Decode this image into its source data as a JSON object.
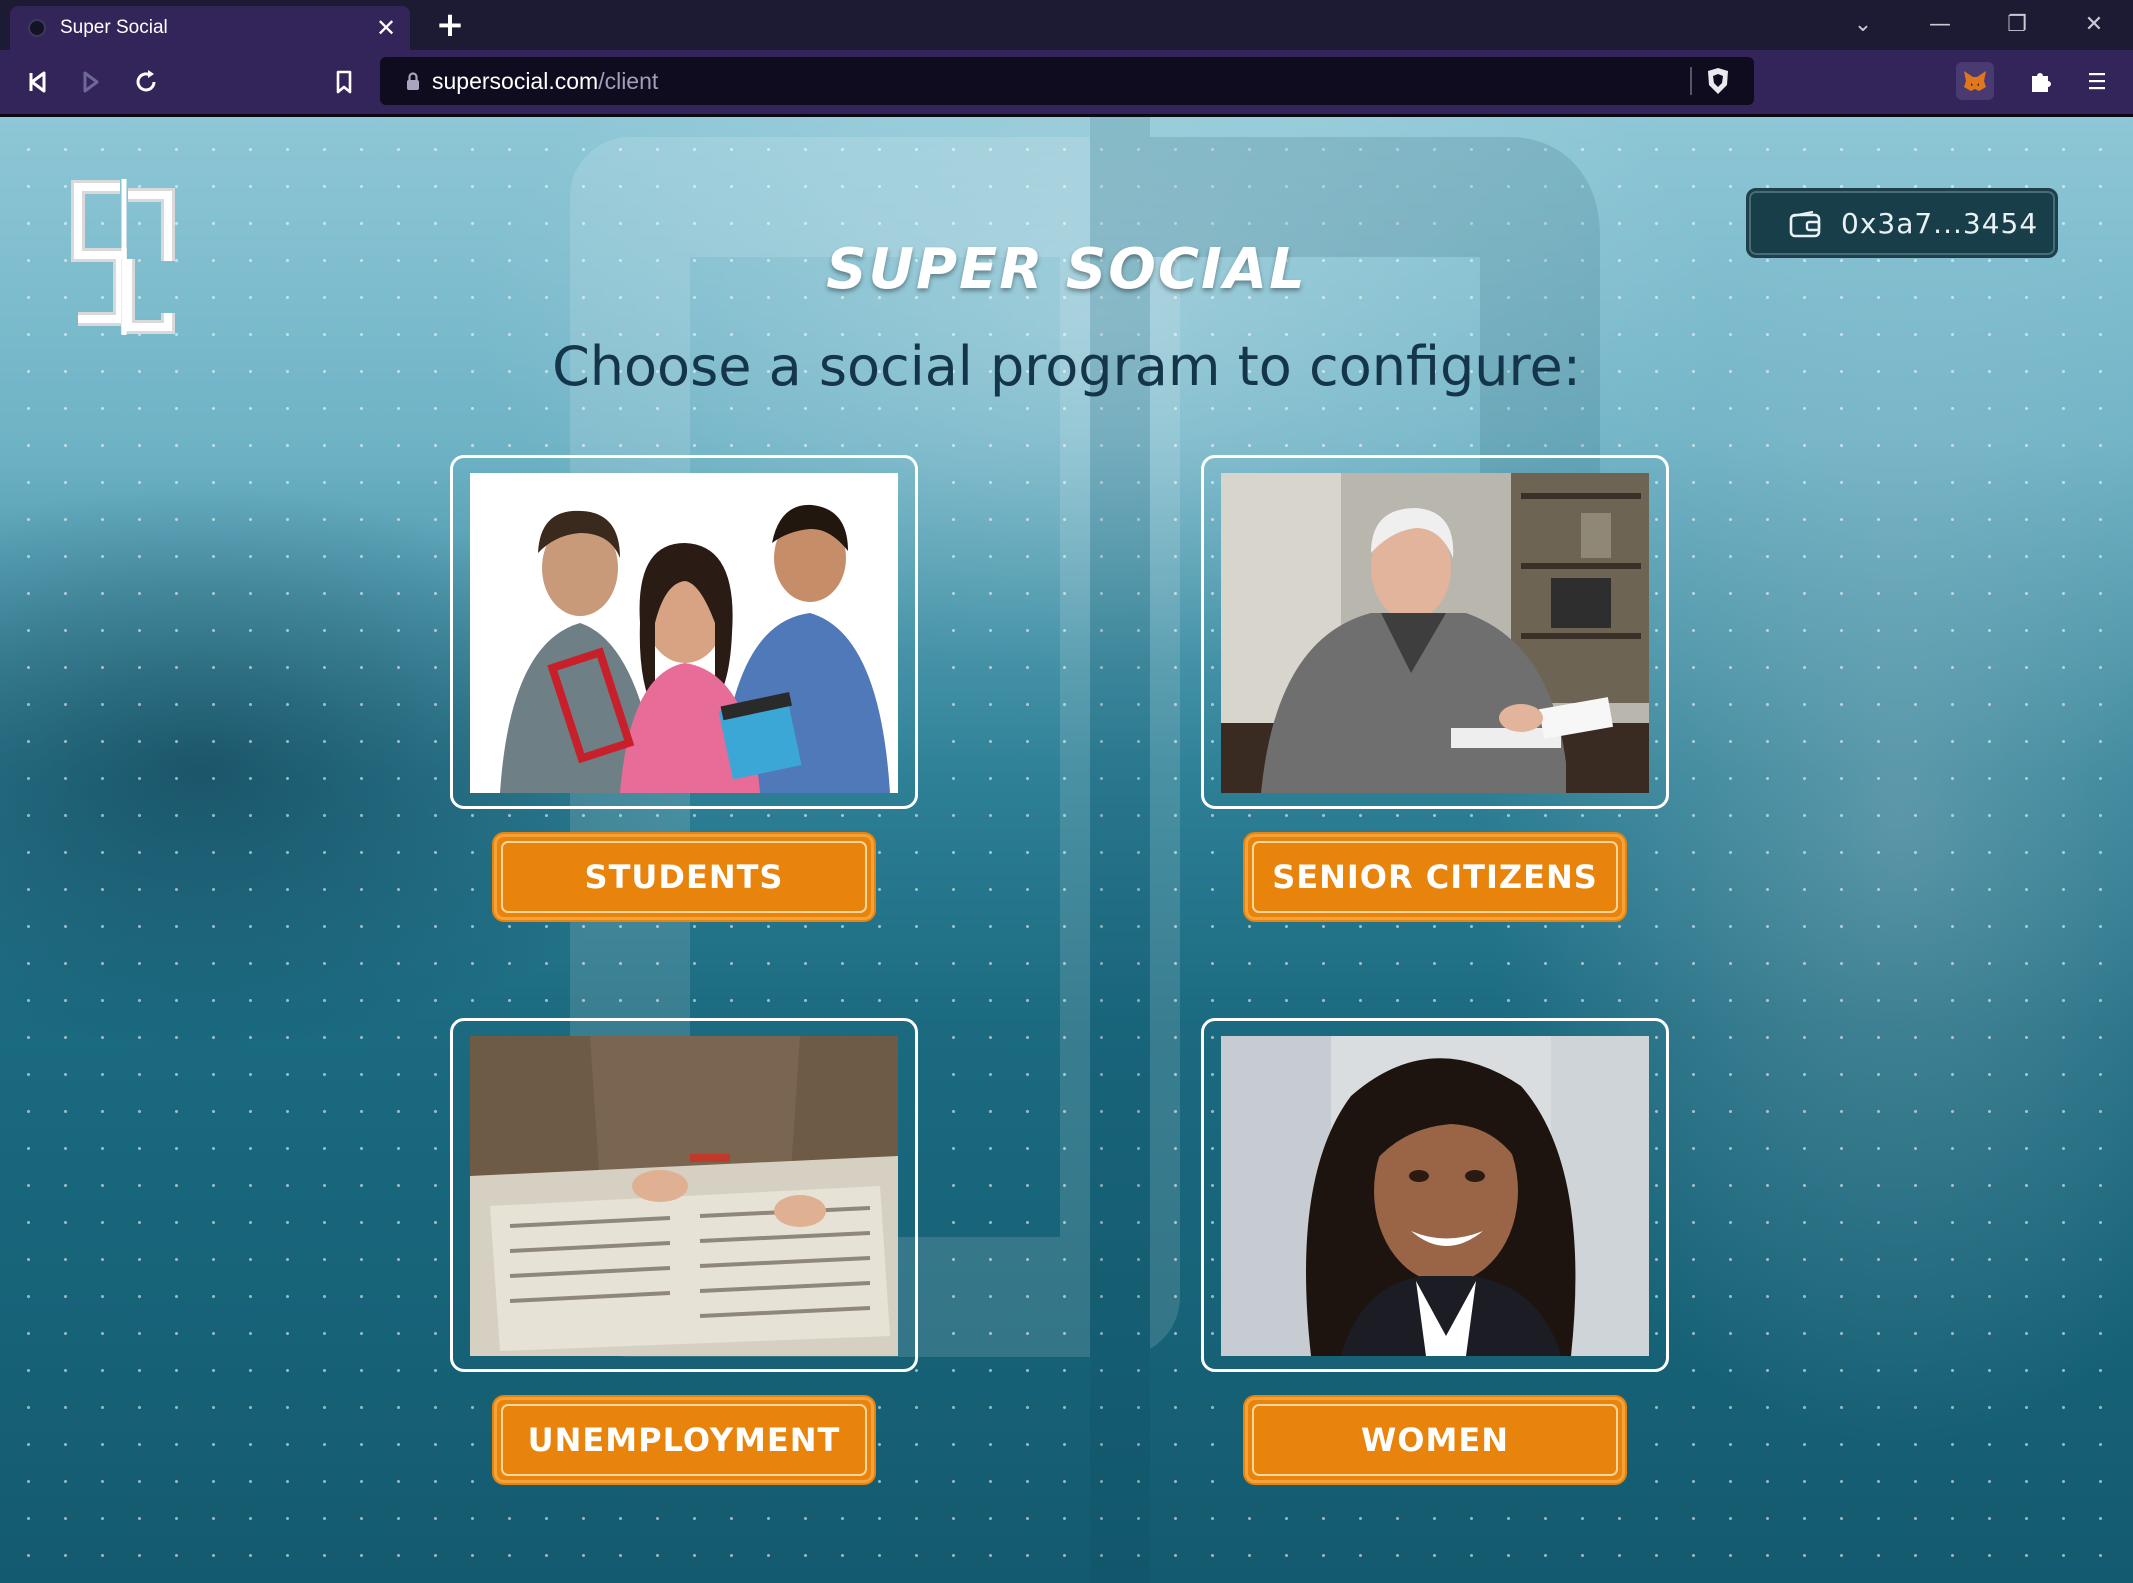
{
  "browser": {
    "tab_title": "Super Social",
    "tab_close": "✕",
    "new_tab": "+",
    "url_host": "supersocial.com",
    "url_path": "/client",
    "window_controls": [
      "⌄",
      "—",
      "❐",
      "✕"
    ]
  },
  "header": {
    "brand": "SUPER SOCIAL",
    "subtitle": "Choose a social program to configure:",
    "wallet_address": "0x3a7...3454"
  },
  "programs": [
    {
      "label": "STUDENTS",
      "image": "students-photo"
    },
    {
      "label": "SENIOR CITIZENS",
      "image": "senior-citizen-photo"
    },
    {
      "label": "UNEMPLOYMENT",
      "image": "newspaper-job-ads-photo"
    },
    {
      "label": "WOMEN",
      "image": "woman-portrait-photo"
    }
  ],
  "colors": {
    "button_orange": "#e8830b",
    "browser_purple": "#33245a",
    "wallet_bg": "#173e49",
    "subtitle_text": "#15364a"
  }
}
